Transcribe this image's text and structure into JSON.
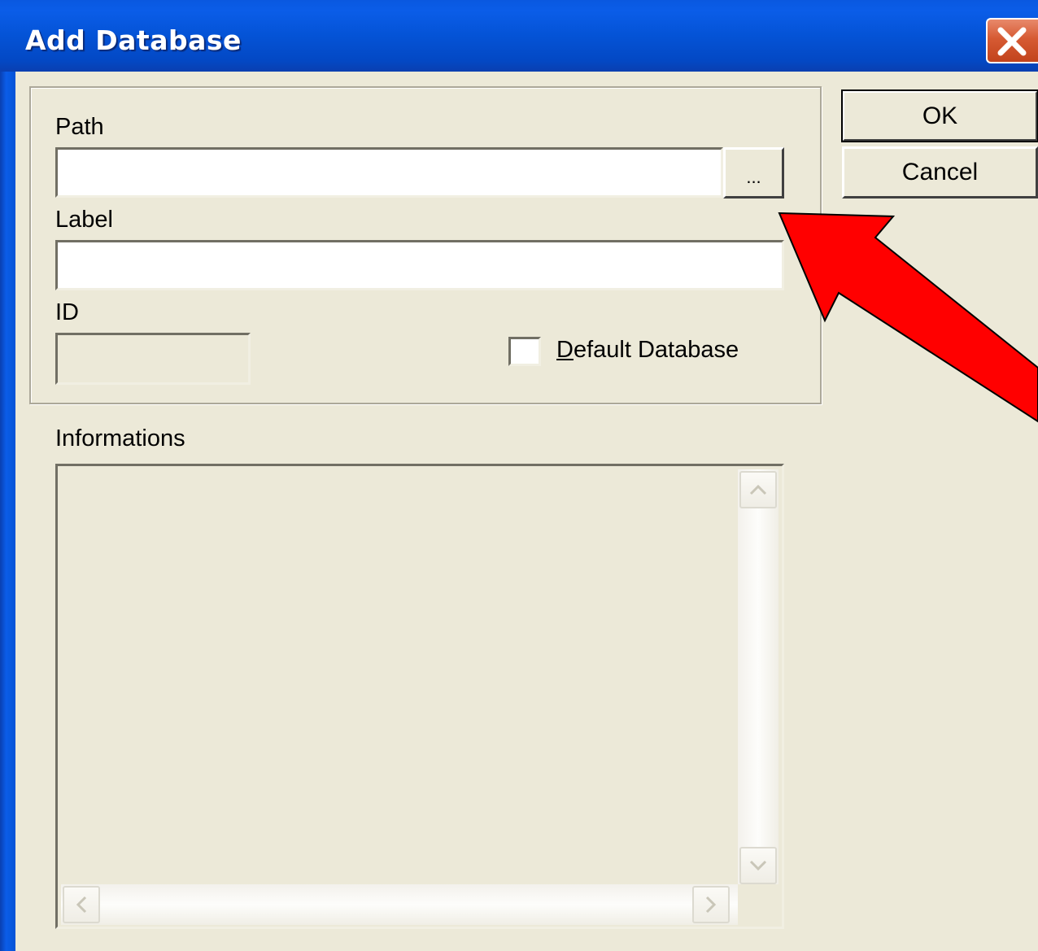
{
  "window": {
    "title": "Add Database",
    "close_icon": "close-icon"
  },
  "form": {
    "path_label": "Path",
    "path_value": "",
    "browse_label": "...",
    "label_label": "Label",
    "label_value": "",
    "id_label": "ID",
    "id_value": "",
    "default_db": {
      "mnemonic": "D",
      "rest": "efault Database",
      "checked": false
    },
    "info_label": "Informations",
    "info_value": ""
  },
  "buttons": {
    "ok": "OK",
    "cancel": "Cancel"
  },
  "annotation": {
    "arrow_color": "#ff0000",
    "icon": "red-arrow-icon"
  },
  "colors": {
    "titlebar": "#0453d6",
    "dialog_bg": "#ece9d8",
    "close_button": "#d65a33"
  }
}
